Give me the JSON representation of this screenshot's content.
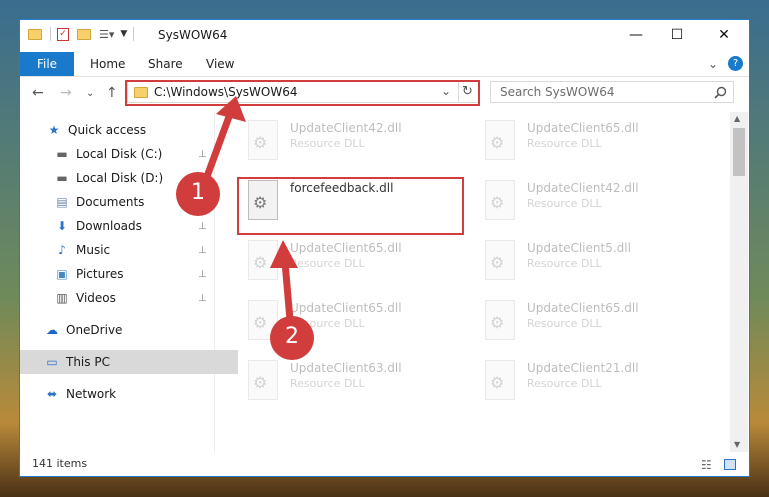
{
  "window": {
    "title": "SysWOW64",
    "controls": {
      "minimize": "—",
      "maximize": "☐",
      "close": "✕"
    }
  },
  "ribbon": {
    "tabs": [
      "File",
      "Home",
      "Share",
      "View"
    ],
    "expand_icon": "⌄",
    "help_icon": "?"
  },
  "address": {
    "path": "C:\\Windows\\SysWOW64",
    "back_icon": "←",
    "forward_icon": "→",
    "recent_icon": "⌄",
    "up_icon": "↑",
    "refresh_icon": "↻",
    "dropdown_icon": "⌄"
  },
  "search": {
    "placeholder": "Search SysWOW64"
  },
  "nav": {
    "items": [
      {
        "label": "Quick access",
        "icon": "★"
      },
      {
        "label": "Local Disk (C:)",
        "icon": "▬"
      },
      {
        "label": "Local Disk (D:)",
        "icon": "▬"
      },
      {
        "label": "Documents",
        "icon": "▤"
      },
      {
        "label": "Downloads",
        "icon": "⬇"
      },
      {
        "label": "Music",
        "icon": "♪"
      },
      {
        "label": "Pictures",
        "icon": "▣"
      },
      {
        "label": "Videos",
        "icon": "▥"
      },
      {
        "label": "OneDrive",
        "icon": "☁"
      },
      {
        "label": "This PC",
        "icon": "▭"
      },
      {
        "label": "Network",
        "icon": "⬌"
      }
    ],
    "pin_icon": "📌"
  },
  "files": {
    "left": [
      {
        "name": "UpdateClient42.dll",
        "type": "Resource DLL"
      },
      {
        "name": "forcefeedback.dll",
        "type": ""
      },
      {
        "name": "UpdateClient65.dll",
        "type": "Resource DLL"
      },
      {
        "name": "UpdateClient65.dll",
        "type": "Resource DLL"
      },
      {
        "name": "UpdateClient63.dll",
        "type": "Resource DLL"
      }
    ],
    "right": [
      {
        "name": "UpdateClient65.dll",
        "type": "Resource DLL"
      },
      {
        "name": "UpdateClient42.dll",
        "type": "Resource DLL"
      },
      {
        "name": "UpdateClient5.dll",
        "type": "Resource DLL"
      },
      {
        "name": "UpdateClient65.dll",
        "type": "Resource DLL"
      },
      {
        "name": "UpdateClient21.dll",
        "type": "Resource DLL"
      }
    ]
  },
  "status": {
    "items_count": "141 items"
  },
  "annotations": {
    "badge1": "1",
    "badge2": "2",
    "accent_color": "#d13d3d"
  }
}
